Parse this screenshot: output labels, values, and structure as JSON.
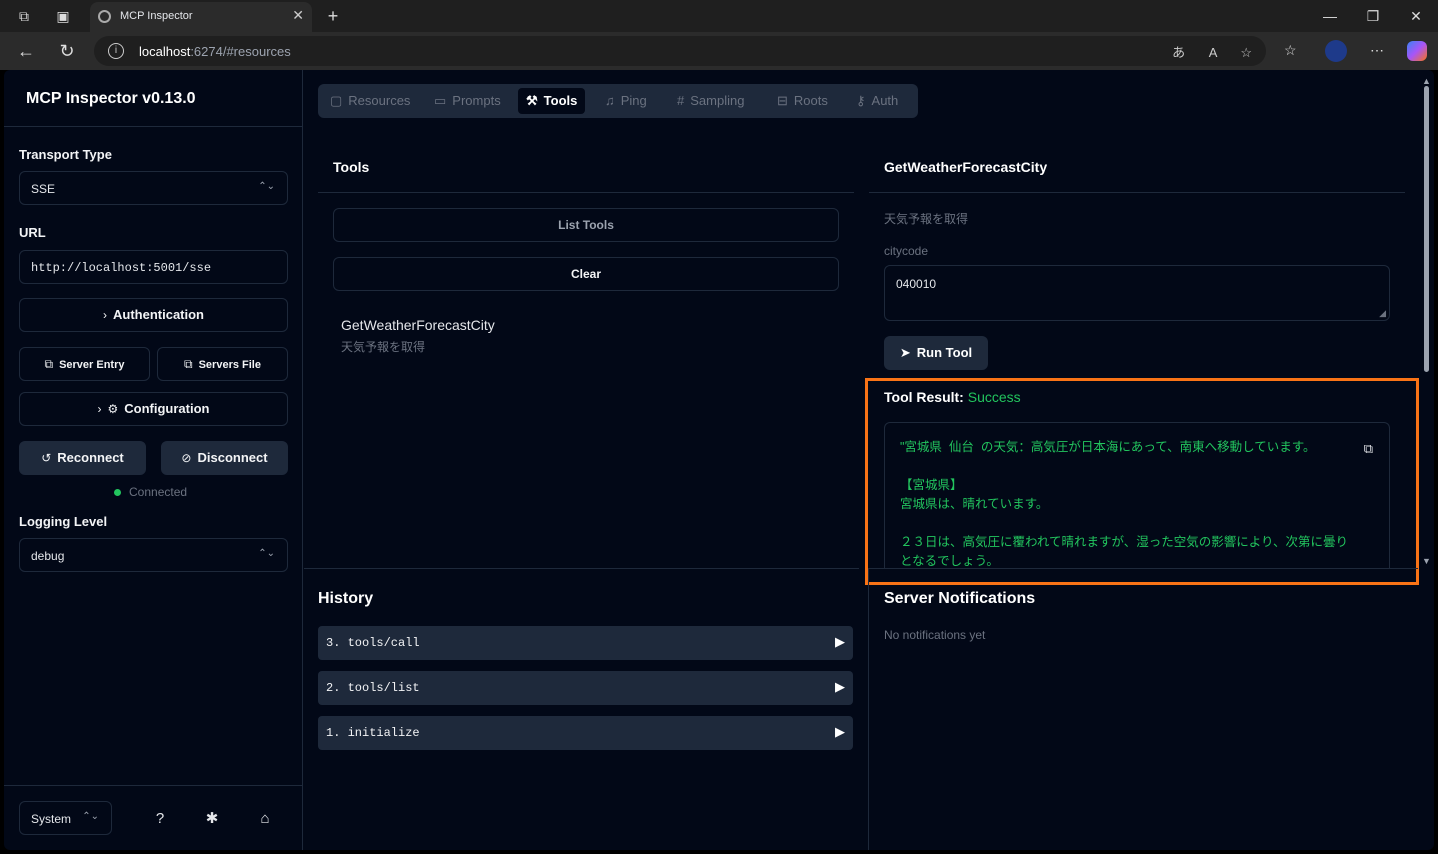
{
  "browser": {
    "tab_title": "MCP Inspector",
    "url_host": "localhost",
    "url_rest": ":6274/#resources"
  },
  "sidebar": {
    "title": "MCP Inspector v0.13.0",
    "transport_label": "Transport Type",
    "transport_value": "SSE",
    "url_label": "URL",
    "url_value": "http://localhost:5001/sse",
    "auth_button": "Authentication",
    "server_entry": "Server Entry",
    "servers_file": "Servers File",
    "config_button": "Configuration",
    "reconnect": "Reconnect",
    "disconnect": "Disconnect",
    "status": "Connected",
    "logging_label": "Logging Level",
    "logging_value": "debug",
    "theme_value": "System"
  },
  "tabs": [
    {
      "label": "Resources",
      "icon": "file-icon"
    },
    {
      "label": "Prompts",
      "icon": "message-icon"
    },
    {
      "label": "Tools",
      "icon": "hammer-icon"
    },
    {
      "label": "Ping",
      "icon": "bell-icon"
    },
    {
      "label": "Sampling",
      "icon": "hash-icon"
    },
    {
      "label": "Roots",
      "icon": "tree-icon"
    },
    {
      "label": "Auth",
      "icon": "key-icon"
    }
  ],
  "tools_panel": {
    "title": "Tools",
    "list_button": "List Tools",
    "clear_button": "Clear",
    "tool_name": "GetWeatherForecastCity",
    "tool_desc": "天気予報を取得"
  },
  "detail_panel": {
    "title": "GetWeatherForecastCity",
    "desc": "天気予報を取得",
    "param_label": "citycode",
    "param_value": "040010",
    "run_button": "Run Tool",
    "result_label": "Tool Result:",
    "result_status": "Success",
    "result_text": "\"宮城県  仙台  の天気：高気圧が日本海にあって、南東へ移動しています。\n\n【宮城県】\n宮城県は、晴れています。\n\n２３日は、高気圧に覆われて晴れますが、湿った空気の影響により、次第に曇りとなるでしょう。"
  },
  "history": {
    "title": "History",
    "items": [
      "3. tools/call",
      "2. tools/list",
      "1. initialize"
    ]
  },
  "notifications": {
    "title": "Server Notifications",
    "empty": "No notifications yet"
  },
  "colors": {
    "accent_success": "#22c55e",
    "highlight": "#f97316",
    "bg": "#020817"
  }
}
